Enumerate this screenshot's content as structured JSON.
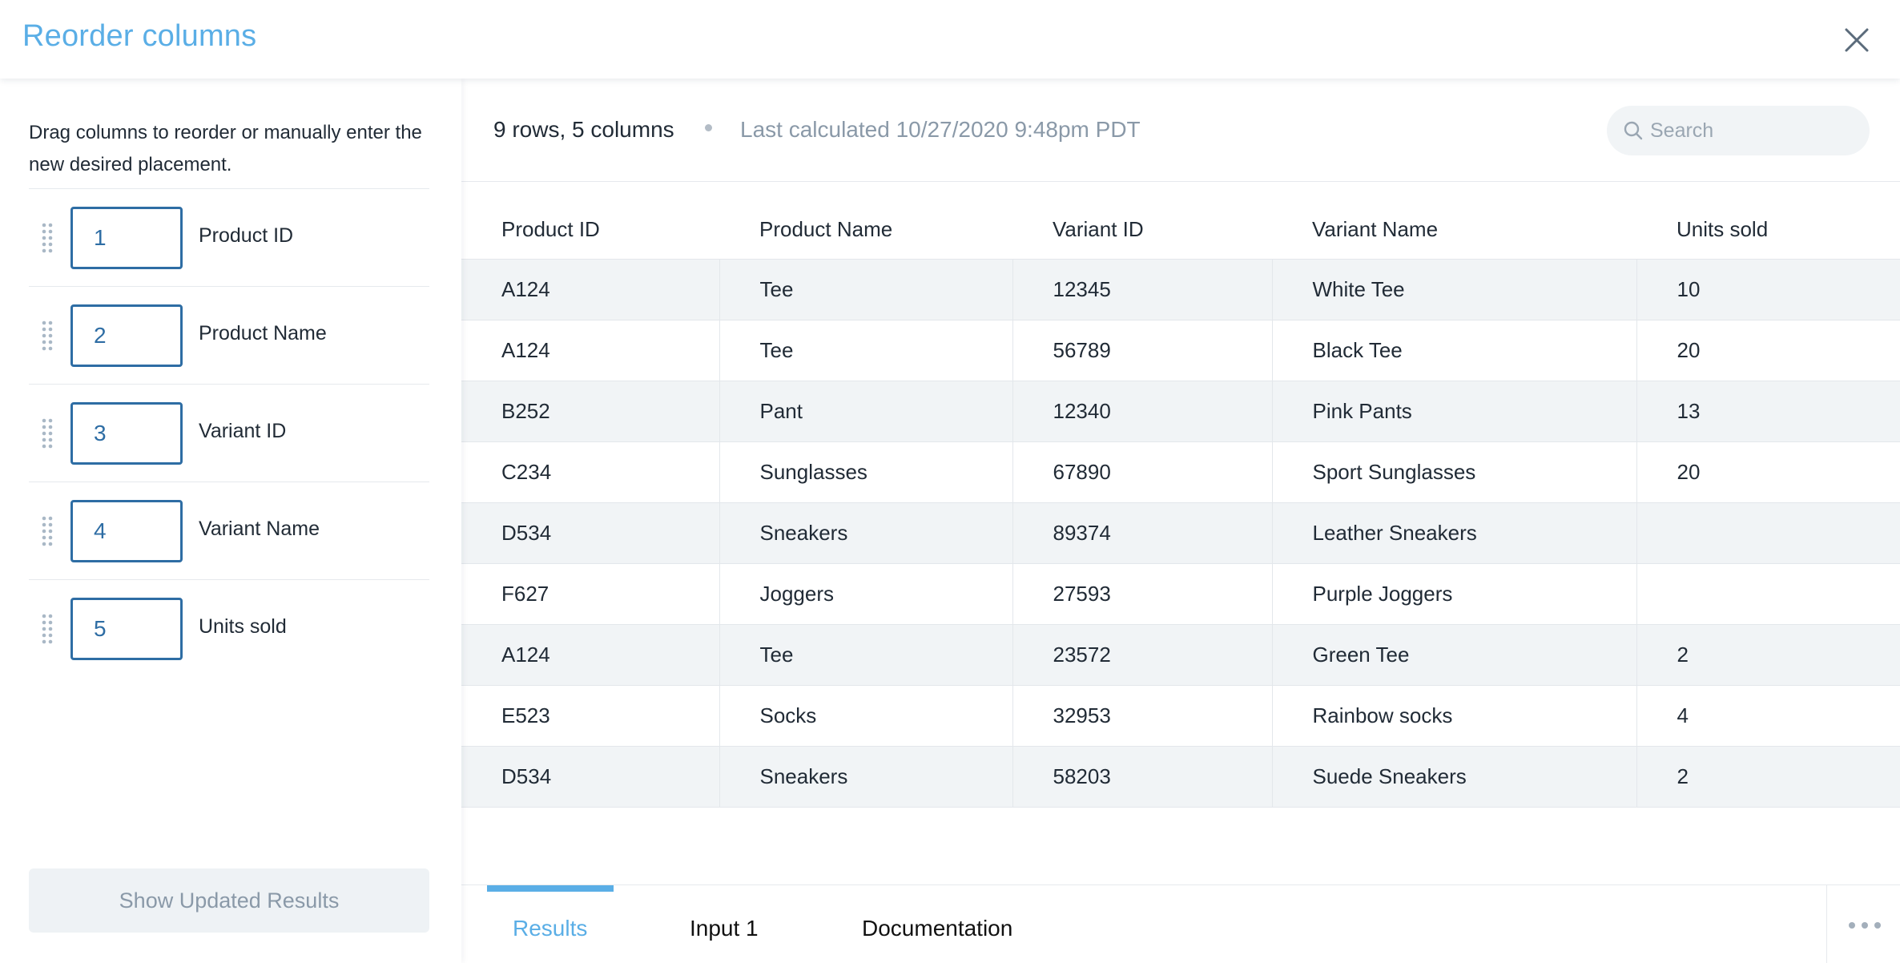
{
  "header": {
    "title": "Reorder columns"
  },
  "left_panel": {
    "instructions": "Drag columns to reorder or manually enter the new desired placement.",
    "columns": [
      {
        "position": "1",
        "label": "Product ID"
      },
      {
        "position": "2",
        "label": "Product Name"
      },
      {
        "position": "3",
        "label": "Variant ID"
      },
      {
        "position": "4",
        "label": "Variant Name"
      },
      {
        "position": "5",
        "label": "Units sold"
      }
    ],
    "update_button": "Show Updated Results"
  },
  "summary": {
    "counts": "9 rows, 5 columns",
    "last_calculated": "Last calculated 10/27/2020 9:48pm PDT"
  },
  "search": {
    "placeholder": "Search",
    "value": ""
  },
  "table": {
    "headers": [
      "Product ID",
      "Product Name",
      "Variant ID",
      "Variant Name",
      "Units sold"
    ],
    "rows": [
      [
        "A124",
        "Tee",
        "12345",
        "White Tee",
        "10"
      ],
      [
        "A124",
        "Tee",
        "56789",
        "Black Tee",
        "20"
      ],
      [
        "B252",
        "Pant",
        "12340",
        "Pink Pants",
        "13"
      ],
      [
        "C234",
        "Sunglasses",
        "67890",
        "Sport Sunglasses",
        "20"
      ],
      [
        "D534",
        "Sneakers",
        "89374",
        "Leather Sneakers",
        ""
      ],
      [
        "F627",
        "Joggers",
        "27593",
        "Purple Joggers",
        ""
      ],
      [
        "A124",
        "Tee",
        "23572",
        "Green Tee",
        "2"
      ],
      [
        "E523",
        "Socks",
        "32953",
        "Rainbow socks",
        "4"
      ],
      [
        "D534",
        "Sneakers",
        "58203",
        "Suede Sneakers",
        "2"
      ]
    ]
  },
  "tabs": [
    {
      "label": "Results",
      "active": true
    },
    {
      "label": "Input 1",
      "active": false
    },
    {
      "label": "Documentation",
      "active": false
    }
  ],
  "colors": {
    "accent": "#5aaee6",
    "input_border": "#2e6da4",
    "muted_text": "#8a99a8",
    "row_stripe": "#f1f4f6"
  },
  "icons": {
    "close": "close-icon",
    "drag": "drag-handle-icon",
    "search": "search-icon",
    "more": "more-horizontal-icon"
  }
}
